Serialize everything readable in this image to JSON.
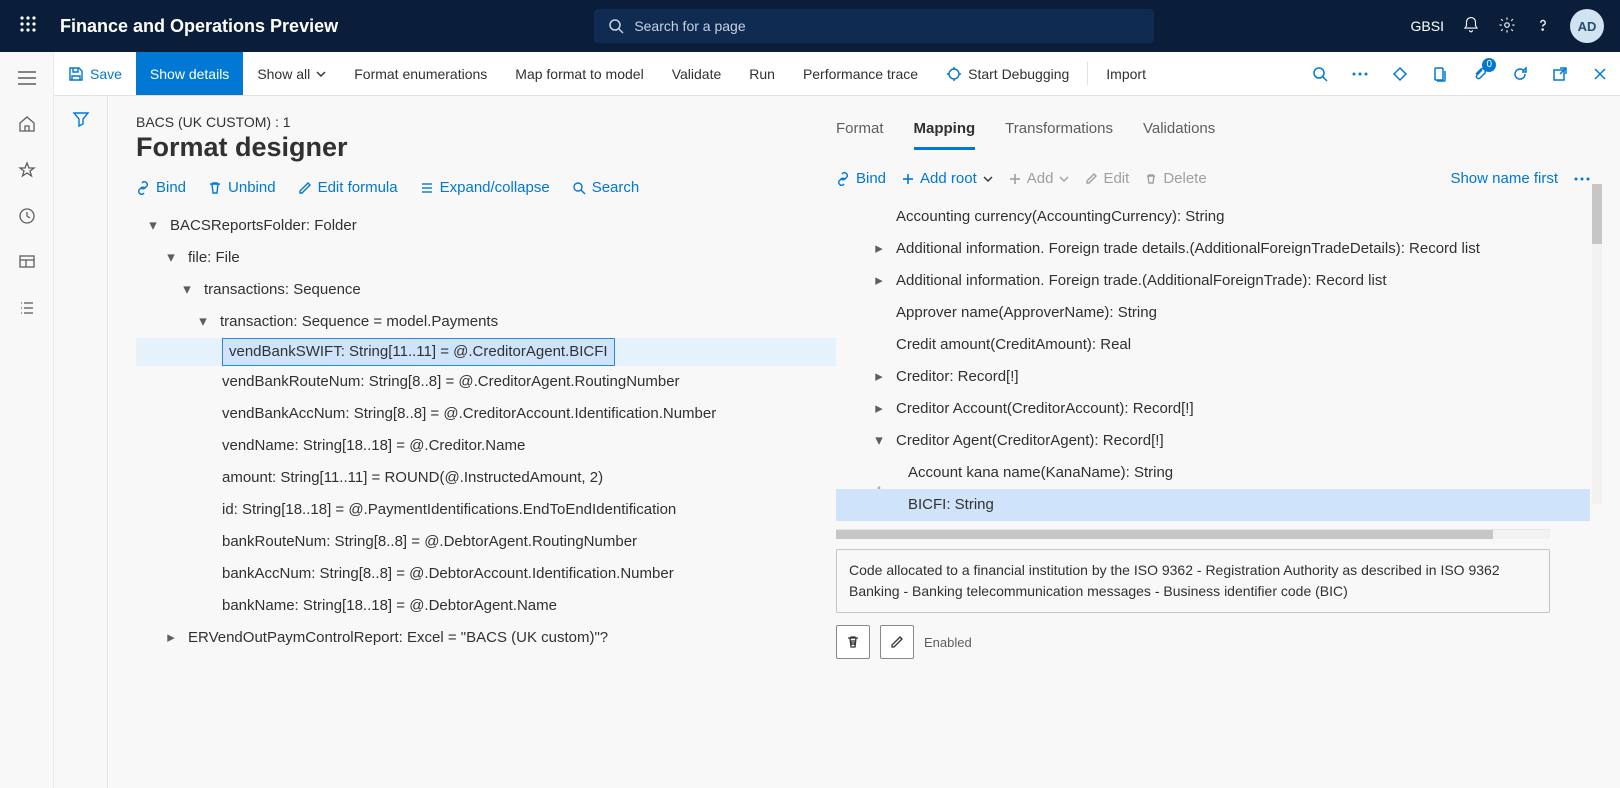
{
  "header": {
    "title": "Finance and Operations Preview",
    "search_placeholder": "Search for a page",
    "company": "GBSI",
    "avatar": "AD"
  },
  "actionbar": {
    "save": "Save",
    "show_details": "Show details",
    "show_all": "Show all",
    "format_enum": "Format enumerations",
    "map_format": "Map format to model",
    "validate": "Validate",
    "run": "Run",
    "perf_trace": "Performance trace",
    "start_debug": "Start Debugging",
    "import": "Import",
    "badge": "0"
  },
  "page": {
    "breadcrumb": "BACS (UK CUSTOM) : 1",
    "title": "Format designer"
  },
  "left_toolbar": {
    "bind": "Bind",
    "unbind": "Unbind",
    "edit_formula": "Edit formula",
    "expand": "Expand/collapse",
    "search": "Search"
  },
  "tree": {
    "n0": "BACSReportsFolder: Folder",
    "n1": "file: File",
    "n2": "transactions: Sequence",
    "n3": "transaction: Sequence = model.Payments",
    "n4": "vendBankSWIFT: String[11..11] = @.CreditorAgent.BICFI",
    "n5": "vendBankRouteNum: String[8..8] = @.CreditorAgent.RoutingNumber",
    "n6": "vendBankAccNum: String[8..8] = @.CreditorAccount.Identification.Number",
    "n7": "vendName: String[18..18] = @.Creditor.Name",
    "n8": "amount: String[11..11] = ROUND(@.InstructedAmount, 2)",
    "n9": "id: String[18..18] = @.PaymentIdentifications.EndToEndIdentification",
    "n10": "bankRouteNum: String[8..8] = @.DebtorAgent.RoutingNumber",
    "n11": "bankAccNum: String[8..8] = @.DebtorAccount.Identification.Number",
    "n12": "bankName: String[18..18] = @.DebtorAgent.Name",
    "n13": "ERVendOutPaymControlReport: Excel = \"BACS (UK custom)\"?"
  },
  "tabs": {
    "format": "Format",
    "mapping": "Mapping",
    "transformations": "Transformations",
    "validations": "Validations"
  },
  "right_toolbar": {
    "bind": "Bind",
    "add_root": "Add root",
    "add": "Add",
    "edit": "Edit",
    "delete": "Delete",
    "show_name": "Show name first"
  },
  "maptree": {
    "m0": "Accounting currency(AccountingCurrency): String",
    "m1": "Additional information. Foreign trade details.(AdditionalForeignTradeDetails): Record list",
    "m2": "Additional information. Foreign trade.(AdditionalForeignTrade): Record list",
    "m3": "Approver name(ApproverName): String",
    "m4": "Credit amount(CreditAmount): Real",
    "m5": "Creditor: Record[!]",
    "m6": "Creditor Account(CreditorAccount): Record[!]",
    "m7": "Creditor Agent(CreditorAgent): Record[!]",
    "m8": "Account kana name(KanaName): String",
    "m9": "BICFI: String"
  },
  "description": "Code allocated to a financial institution by the ISO 9362 - Registration Authority as described in ISO 9362 Banking - Banking telecommunication messages - Business identifier code (BIC)",
  "enabled_label": "Enabled"
}
